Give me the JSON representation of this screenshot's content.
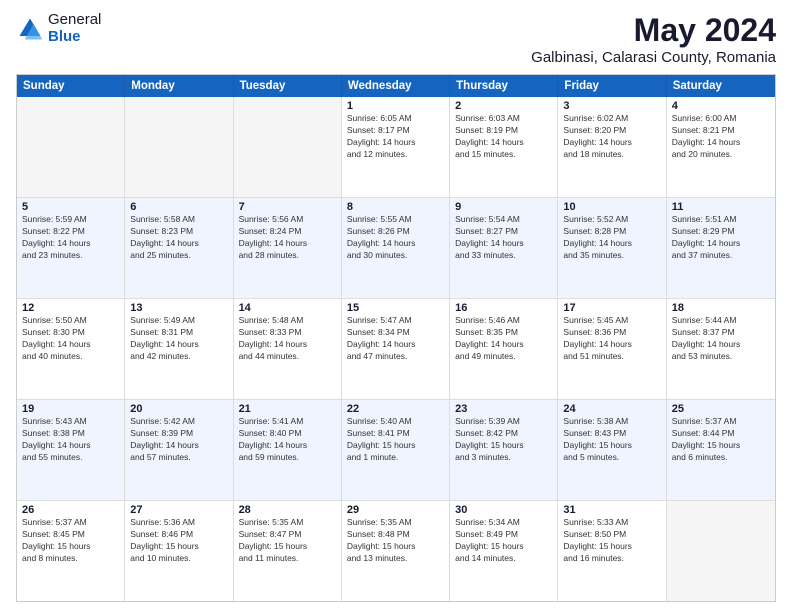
{
  "logo": {
    "general": "General",
    "blue": "Blue"
  },
  "title": "May 2024",
  "subtitle": "Galbinasi, Calarasi County, Romania",
  "headers": [
    "Sunday",
    "Monday",
    "Tuesday",
    "Wednesday",
    "Thursday",
    "Friday",
    "Saturday"
  ],
  "rows": [
    [
      {
        "num": "",
        "info": ""
      },
      {
        "num": "",
        "info": ""
      },
      {
        "num": "",
        "info": ""
      },
      {
        "num": "1",
        "info": "Sunrise: 6:05 AM\nSunset: 8:17 PM\nDaylight: 14 hours\nand 12 minutes."
      },
      {
        "num": "2",
        "info": "Sunrise: 6:03 AM\nSunset: 8:19 PM\nDaylight: 14 hours\nand 15 minutes."
      },
      {
        "num": "3",
        "info": "Sunrise: 6:02 AM\nSunset: 8:20 PM\nDaylight: 14 hours\nand 18 minutes."
      },
      {
        "num": "4",
        "info": "Sunrise: 6:00 AM\nSunset: 8:21 PM\nDaylight: 14 hours\nand 20 minutes."
      }
    ],
    [
      {
        "num": "5",
        "info": "Sunrise: 5:59 AM\nSunset: 8:22 PM\nDaylight: 14 hours\nand 23 minutes."
      },
      {
        "num": "6",
        "info": "Sunrise: 5:58 AM\nSunset: 8:23 PM\nDaylight: 14 hours\nand 25 minutes."
      },
      {
        "num": "7",
        "info": "Sunrise: 5:56 AM\nSunset: 8:24 PM\nDaylight: 14 hours\nand 28 minutes."
      },
      {
        "num": "8",
        "info": "Sunrise: 5:55 AM\nSunset: 8:26 PM\nDaylight: 14 hours\nand 30 minutes."
      },
      {
        "num": "9",
        "info": "Sunrise: 5:54 AM\nSunset: 8:27 PM\nDaylight: 14 hours\nand 33 minutes."
      },
      {
        "num": "10",
        "info": "Sunrise: 5:52 AM\nSunset: 8:28 PM\nDaylight: 14 hours\nand 35 minutes."
      },
      {
        "num": "11",
        "info": "Sunrise: 5:51 AM\nSunset: 8:29 PM\nDaylight: 14 hours\nand 37 minutes."
      }
    ],
    [
      {
        "num": "12",
        "info": "Sunrise: 5:50 AM\nSunset: 8:30 PM\nDaylight: 14 hours\nand 40 minutes."
      },
      {
        "num": "13",
        "info": "Sunrise: 5:49 AM\nSunset: 8:31 PM\nDaylight: 14 hours\nand 42 minutes."
      },
      {
        "num": "14",
        "info": "Sunrise: 5:48 AM\nSunset: 8:33 PM\nDaylight: 14 hours\nand 44 minutes."
      },
      {
        "num": "15",
        "info": "Sunrise: 5:47 AM\nSunset: 8:34 PM\nDaylight: 14 hours\nand 47 minutes."
      },
      {
        "num": "16",
        "info": "Sunrise: 5:46 AM\nSunset: 8:35 PM\nDaylight: 14 hours\nand 49 minutes."
      },
      {
        "num": "17",
        "info": "Sunrise: 5:45 AM\nSunset: 8:36 PM\nDaylight: 14 hours\nand 51 minutes."
      },
      {
        "num": "18",
        "info": "Sunrise: 5:44 AM\nSunset: 8:37 PM\nDaylight: 14 hours\nand 53 minutes."
      }
    ],
    [
      {
        "num": "19",
        "info": "Sunrise: 5:43 AM\nSunset: 8:38 PM\nDaylight: 14 hours\nand 55 minutes."
      },
      {
        "num": "20",
        "info": "Sunrise: 5:42 AM\nSunset: 8:39 PM\nDaylight: 14 hours\nand 57 minutes."
      },
      {
        "num": "21",
        "info": "Sunrise: 5:41 AM\nSunset: 8:40 PM\nDaylight: 14 hours\nand 59 minutes."
      },
      {
        "num": "22",
        "info": "Sunrise: 5:40 AM\nSunset: 8:41 PM\nDaylight: 15 hours\nand 1 minute."
      },
      {
        "num": "23",
        "info": "Sunrise: 5:39 AM\nSunset: 8:42 PM\nDaylight: 15 hours\nand 3 minutes."
      },
      {
        "num": "24",
        "info": "Sunrise: 5:38 AM\nSunset: 8:43 PM\nDaylight: 15 hours\nand 5 minutes."
      },
      {
        "num": "25",
        "info": "Sunrise: 5:37 AM\nSunset: 8:44 PM\nDaylight: 15 hours\nand 6 minutes."
      }
    ],
    [
      {
        "num": "26",
        "info": "Sunrise: 5:37 AM\nSunset: 8:45 PM\nDaylight: 15 hours\nand 8 minutes."
      },
      {
        "num": "27",
        "info": "Sunrise: 5:36 AM\nSunset: 8:46 PM\nDaylight: 15 hours\nand 10 minutes."
      },
      {
        "num": "28",
        "info": "Sunrise: 5:35 AM\nSunset: 8:47 PM\nDaylight: 15 hours\nand 11 minutes."
      },
      {
        "num": "29",
        "info": "Sunrise: 5:35 AM\nSunset: 8:48 PM\nDaylight: 15 hours\nand 13 minutes."
      },
      {
        "num": "30",
        "info": "Sunrise: 5:34 AM\nSunset: 8:49 PM\nDaylight: 15 hours\nand 14 minutes."
      },
      {
        "num": "31",
        "info": "Sunrise: 5:33 AM\nSunset: 8:50 PM\nDaylight: 15 hours\nand 16 minutes."
      },
      {
        "num": "",
        "info": ""
      }
    ]
  ]
}
